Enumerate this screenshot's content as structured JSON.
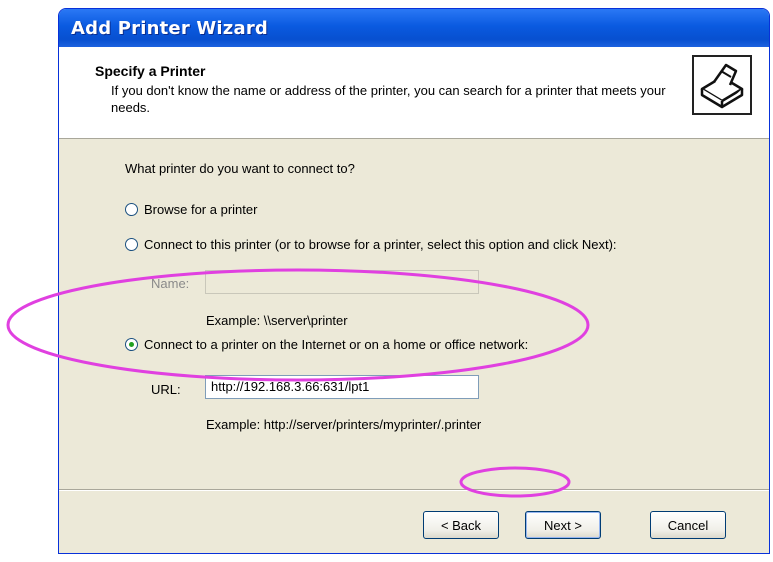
{
  "window": {
    "title": "Add Printer Wizard"
  },
  "header": {
    "title": "Specify a Printer",
    "subtitle": "If you don't know the name or address of the printer, you can search for a printer that meets your needs.",
    "icon": "printer-icon"
  },
  "main": {
    "question": "What printer do you want to connect to?",
    "options": [
      {
        "label": "Browse for a printer",
        "checked": false
      },
      {
        "label": "Connect to this printer (or to browse for a printer, select this option and click Next):",
        "checked": false
      },
      {
        "label": "Connect to a printer on the Internet or on a home or office network:",
        "checked": true
      }
    ],
    "name_field": {
      "label": "Name:",
      "value": ""
    },
    "name_example": "Example: \\\\server\\printer",
    "url_field": {
      "label": "URL:",
      "value": "http://192.168.3.66:631/lpt1"
    },
    "url_example": "Example: http://server/printers/myprinter/.printer"
  },
  "buttons": {
    "back": "< Back",
    "next": "Next >",
    "cancel": "Cancel"
  },
  "colors": {
    "title_bar": "#0a5ae0",
    "annotation": "#e040e0",
    "radio_selected": "#21a121"
  }
}
